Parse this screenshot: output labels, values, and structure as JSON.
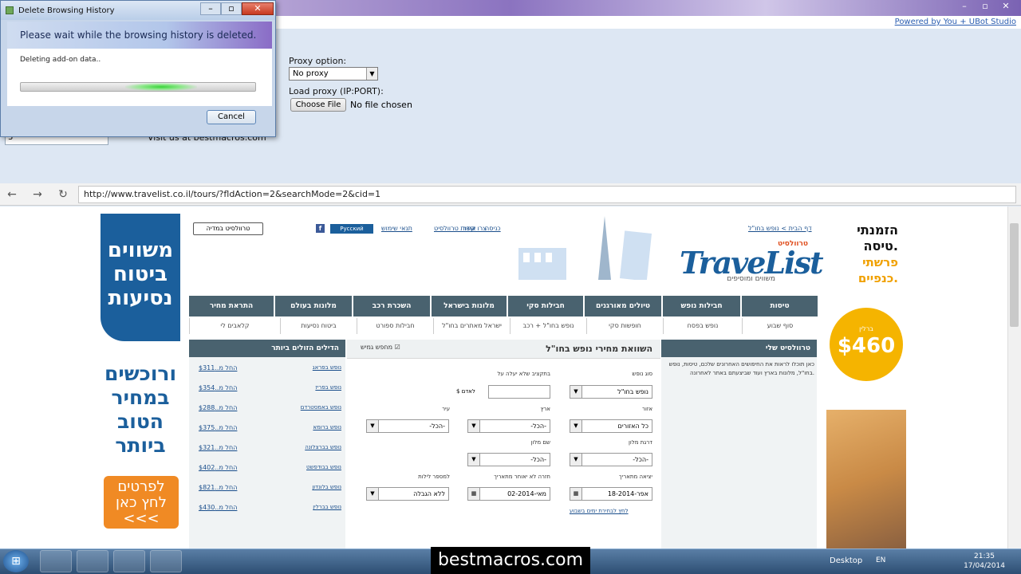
{
  "app": {
    "powered_by": "Powered by You + UBot Studio",
    "window_controls": [
      "–",
      "▫",
      "✕"
    ]
  },
  "settings": {
    "proxy_option_label": "Proxy option:",
    "proxy_value": "No proxy",
    "load_proxy_label": "Load proxy (IP:PORT):",
    "choose_file_label": "Choose File",
    "no_file_label": "No file chosen",
    "visit_text": "Visit us at bestmacros.com",
    "small_input_value": "3"
  },
  "dialog": {
    "title": "Delete Browsing History",
    "banner": "Please wait while the browsing history is deleted.",
    "status": "Deleting add-on data..",
    "progress": 0.6,
    "cancel_label": "Cancel",
    "min": "–",
    "max": "▫",
    "close": "✕"
  },
  "browser": {
    "back": "←",
    "forward": "→",
    "reload": "↻",
    "url": "http://www.travelist.co.il/tours/?fldAction=2&searchMode=2&cid=1"
  },
  "page": {
    "left_ad": {
      "line1": "משווים",
      "line2": "ביטוח",
      "line3": "נסיעות",
      "line4": "ורוכשים",
      "line5": "במחיר",
      "line6": "הטוב",
      "line7": "ביותר",
      "button": "לפרטים לחץ כאן <<<"
    },
    "right_ad": {
      "line1": "הזמנתי",
      "line2": "טיסה.",
      "line3": "פרשתי",
      "line4": "כנפיים.",
      "price": "$460",
      "price_city": "ברלין"
    },
    "header": {
      "logo": "TraveList",
      "logo_he": "טרוולסיט",
      "tagline": "משווים ומוסיפים",
      "breadcrumb": "דף הבית > נופש בחו\"ל",
      "links": [
        "כניסה",
        "צרו קשר",
        "אודות טרוולסיט",
        "תנאי שימוש"
      ],
      "russian_btn": "Русский",
      "travelist_btn": "טרוולסיט במדיה",
      "fb_icon": "f"
    },
    "tabs": [
      "טיסות",
      "חבילות נופש",
      "טיולים מאורגנים",
      "חבילות סקי",
      "מלונות בישראל",
      "השכרת רכב",
      "מלונות בעולם",
      "התראת מחיר"
    ],
    "subtabs": [
      "סוף שבוע",
      "נופש בפסח",
      "חופשות סקי",
      "נופש בחו\"ל + רכב",
      "ישראל מאתרים בחו\"ל",
      "חבילות ספורט",
      "ביטוח נסיעות",
      "קלאבים לי"
    ],
    "my_travelist": {
      "heading": "טרוולסיט שלי",
      "text": "כאן תוכלו לראות את החיפושים האחרונים שלכם, טיסות, נופש בחו\"ל, מלונות בארץ ועוד שביצעתם באתר לאחרונה."
    },
    "form": {
      "title": "השוואת מחירי נופש בחו\"ל",
      "flexible_check": "מחפש גמיש",
      "fields": {
        "vacation_type_label": "סוג נופש",
        "vacation_type_value": "נופש בחו\"ל",
        "budget_label": "בתקציב שלא יעלה על",
        "budget_currency": "$ לאדם",
        "region_label": "אזור",
        "region_value": "כל האזורים",
        "country_label": "ארץ",
        "country_value": "-הכל-",
        "city_label": "עיר",
        "city_value": "-הכל-",
        "hotel_rating_label": "דרגת מלון",
        "hotel_rating_value": "-הכל-",
        "hotel_name_label": "שם מלון",
        "hotel_name_value": "-הכל-",
        "depart_label": "יציאה מתאריך",
        "depart_value": "18-אפר-2014",
        "return_label": "חזרה לא יאוחר מתאריך",
        "return_value": "02-מאי-2014",
        "nights_label": "למספר לילות",
        "nights_value": "ללא הגבלה",
        "search_link": "לחץ לבחירת ימים בשבוע"
      }
    },
    "deals": {
      "heading": "הדילים הזולים ביותר",
      "items": [
        {
          "dest": "נופש בפראג",
          "price": "החל מ..$311"
        },
        {
          "dest": "נופש בפריז",
          "price": "החל מ..$354"
        },
        {
          "dest": "נופש באמסטרדם",
          "price": "החל מ..$288"
        },
        {
          "dest": "נופש ברומא",
          "price": "החל מ..$375"
        },
        {
          "dest": "נופש בברצלונה",
          "price": "החל מ..$321"
        },
        {
          "dest": "נופש בבודפשט",
          "price": "החל מ..$402"
        },
        {
          "dest": "נופש בלונדון",
          "price": "החל מ..$821"
        },
        {
          "dest": "נופש בברלין",
          "price": "החל מ..$430"
        }
      ]
    }
  },
  "taskbar": {
    "start": "⊞",
    "desktop": "Desktop",
    "lang": "EN",
    "time": "21:35",
    "date": "17/04/2014",
    "watermark": "bestmacros.com"
  },
  "colors": {
    "tab_bg": "#49626f",
    "brand_blue": "#1b5f9c",
    "accent_orange": "#f08a24",
    "price_yellow": "#f5b400"
  }
}
